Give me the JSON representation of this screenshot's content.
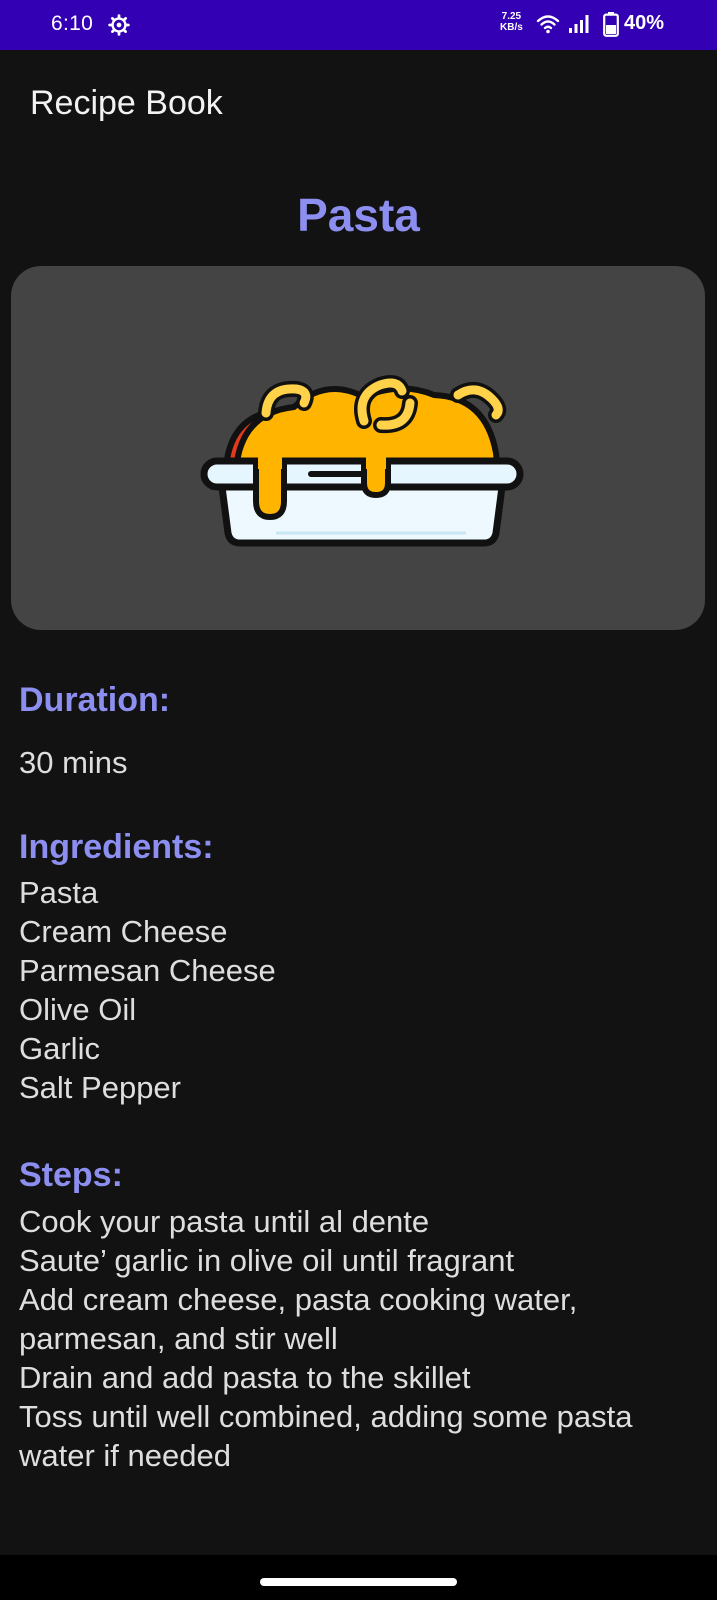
{
  "status_bar": {
    "time": "6:10",
    "speed_value": "7.25",
    "speed_unit": "KB/s",
    "battery_percent": "40%",
    "background_color": "#3300b3",
    "icons": [
      "gear-icon",
      "wifi-icon",
      "signal-icon",
      "battery-icon"
    ]
  },
  "app_bar": {
    "title": "Recipe Book"
  },
  "recipe": {
    "title": "Pasta",
    "image_icon": "baked-pasta-dish-icon",
    "duration_heading": "Duration:",
    "duration": "30 mins",
    "ingredients_heading": "Ingredients:",
    "ingredients": [
      "Pasta",
      "Cream Cheese",
      "Parmesan Cheese",
      "Olive Oil",
      "Garlic",
      "Salt Pepper"
    ],
    "steps_heading": "Steps:",
    "steps_lines": [
      "Cook your pasta until al dente",
      "Saute’ garlic in olive oil until fragrant",
      "Add cream cheese, pasta cooking water,",
      "parmesan, and stir well",
      "Drain and add pasta to the skillet",
      "Toss until well combined, adding some pasta",
      "water if needed"
    ]
  },
  "colors": {
    "accent": "#8c8ff0",
    "background": "#121212",
    "card": "#444444",
    "body_text": "#dedede"
  }
}
